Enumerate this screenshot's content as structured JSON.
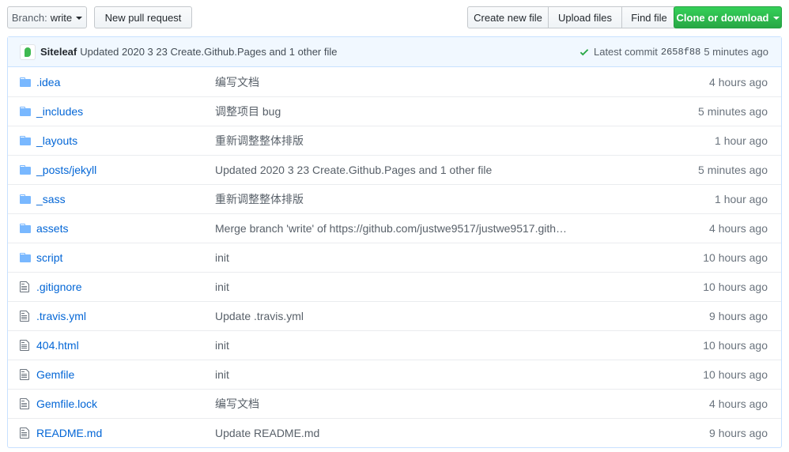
{
  "toolbar": {
    "branch_prefix": "Branch:",
    "branch_name": "write",
    "new_pr_label": "New pull request",
    "create_file_label": "Create new file",
    "upload_files_label": "Upload files",
    "find_file_label": "Find file",
    "clone_label": "Clone or download"
  },
  "commit": {
    "author": "Siteleaf",
    "message": "Updated 2020 3 23 Create.Github.Pages and 1 other file",
    "latest_label": "Latest commit",
    "sha": "2658f88",
    "age": "5 minutes ago"
  },
  "files": [
    {
      "type": "dir",
      "name": ".idea",
      "message": "编写文档",
      "age": "4 hours ago"
    },
    {
      "type": "dir",
      "name": "_includes",
      "message": "调整项目 bug",
      "age": "5 minutes ago"
    },
    {
      "type": "dir",
      "name": "_layouts",
      "message": "重新调整整体排版",
      "age": "1 hour ago"
    },
    {
      "type": "dir",
      "name": "_posts/jekyll",
      "message": "Updated 2020 3 23 Create.Github.Pages and 1 other file",
      "age": "5 minutes ago"
    },
    {
      "type": "dir",
      "name": "_sass",
      "message": "重新调整整体排版",
      "age": "1 hour ago"
    },
    {
      "type": "dir",
      "name": "assets",
      "message": "Merge branch 'write' of https://github.com/justwe9517/justwe9517.gith…",
      "age": "4 hours ago"
    },
    {
      "type": "dir",
      "name": "script",
      "message": "init",
      "age": "10 hours ago"
    },
    {
      "type": "file",
      "name": ".gitignore",
      "message": "init",
      "age": "10 hours ago"
    },
    {
      "type": "file",
      "name": ".travis.yml",
      "message": "Update .travis.yml",
      "age": "9 hours ago"
    },
    {
      "type": "file",
      "name": "404.html",
      "message": "init",
      "age": "10 hours ago"
    },
    {
      "type": "file",
      "name": "Gemfile",
      "message": "init",
      "age": "10 hours ago"
    },
    {
      "type": "file",
      "name": "Gemfile.lock",
      "message": "编写文档",
      "age": "4 hours ago"
    },
    {
      "type": "file",
      "name": "README.md",
      "message": "Update README.md",
      "age": "9 hours ago"
    }
  ],
  "icons": {
    "dir": "folder-icon",
    "file": "file-icon"
  },
  "colors": {
    "link": "#0366d6",
    "primary": "#28a745",
    "commit_bg": "#f1f8ff"
  }
}
